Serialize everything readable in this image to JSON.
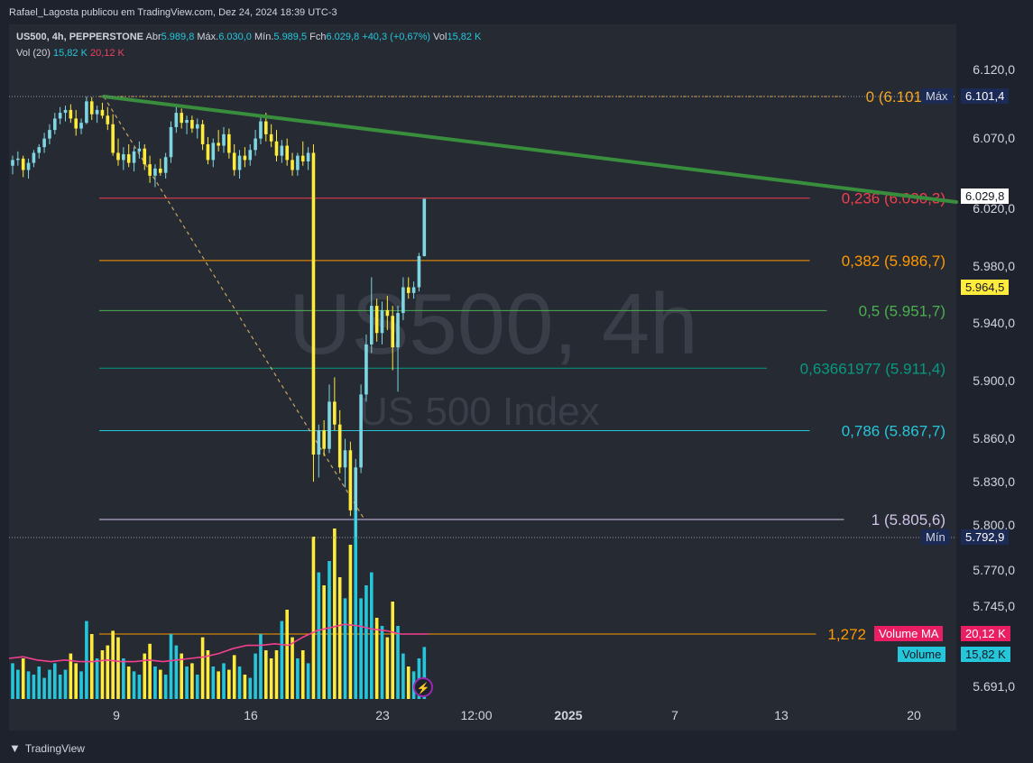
{
  "publisher_line": "Rafael_Lagosta publicou em TradingView.com, Dez 24, 2024 18:39 UTC-3",
  "legend": {
    "symbol": "US500, 4h, PEPPERSTONE",
    "open_label": "Abr",
    "open": "5.989,8",
    "high_label": "Máx.",
    "high": "6.030,0",
    "low_label": "Mín.",
    "low": "5.989,5",
    "close_label": "Fch",
    "close": "6.029,8",
    "change": "+40,3 (+0,67%)",
    "vol_label": "Vol",
    "vol": "15,82 K",
    "vol_indicator": "Vol (20)",
    "vol_value": "15,82 K",
    "vol_ma_value": "20,12 K"
  },
  "watermark": {
    "line1": "US500, 4h",
    "line2": "US 500 Index"
  },
  "price_scale": {
    "ticks": [
      "6.120,0",
      "6.070,0",
      "6.020,0",
      "5.980,0",
      "5.940,0",
      "5.900,0",
      "5.860,0",
      "5.830,0",
      "5.800,0",
      "5.770,0",
      "5.745,0",
      "5.691,0"
    ],
    "max_label": "Máx",
    "max_value": "6.101,4",
    "last_price": "6.029,8",
    "second_price": "5.964,5",
    "min_label": "Mín",
    "min_value": "5.792,9",
    "volume_ma_label": "Volume MA",
    "volume_ma_value": "20,12 K",
    "volume_label": "Volume",
    "volume_value": "15,82 K"
  },
  "time_scale": {
    "ticks": [
      "9",
      "16",
      "23",
      "12:00",
      "2025",
      "7",
      "13",
      "20"
    ]
  },
  "fib_levels": [
    {
      "label": "0 (6.101",
      "color": "#f5a623"
    },
    {
      "label": "0,236 (6.030,3)",
      "color": "#f23f4d"
    },
    {
      "label": "0,382 (5.986,7)",
      "color": "#ff9800"
    },
    {
      "label": "0,5 (5.951,7)",
      "color": "#4caf50"
    },
    {
      "label": "0,63661977 (5.911,4)",
      "color": "#089981"
    },
    {
      "label": "0,786 (5.867,7)",
      "color": "#26c6da"
    },
    {
      "label": "1 (5.805,6)",
      "color": "#d1c4e9"
    },
    {
      "label": "1,272",
      "color": "#ff9800"
    }
  ],
  "footer": {
    "brand": "TradingView"
  },
  "chart_data": {
    "type": "candlestick",
    "title": "US500, 4h, PEPPERSTONE",
    "subtitle": "US 500 Index",
    "ylim": [
      5691,
      6130
    ],
    "x_ticks": [
      "9",
      "16",
      "23",
      "12:00",
      "2025",
      "7",
      "13",
      "20"
    ],
    "candles": [
      {
        "o": 6053,
        "h": 6060,
        "l": 6047,
        "c": 6057,
        "v": 0.22
      },
      {
        "o": 6057,
        "h": 6063,
        "l": 6053,
        "c": 6058,
        "v": 0.18
      },
      {
        "o": 6058,
        "h": 6060,
        "l": 6045,
        "c": 6050,
        "v": 0.25
      },
      {
        "o": 6050,
        "h": 6058,
        "l": 6044,
        "c": 6055,
        "v": 0.17
      },
      {
        "o": 6055,
        "h": 6064,
        "l": 6052,
        "c": 6062,
        "v": 0.15
      },
      {
        "o": 6062,
        "h": 6068,
        "l": 6058,
        "c": 6066,
        "v": 0.2
      },
      {
        "o": 6066,
        "h": 6076,
        "l": 6062,
        "c": 6072,
        "v": 0.13
      },
      {
        "o": 6072,
        "h": 6082,
        "l": 6068,
        "c": 6078,
        "v": 0.18
      },
      {
        "o": 6078,
        "h": 6090,
        "l": 6075,
        "c": 6086,
        "v": 0.22
      },
      {
        "o": 6086,
        "h": 6094,
        "l": 6082,
        "c": 6090,
        "v": 0.15
      },
      {
        "o": 6090,
        "h": 6095,
        "l": 6084,
        "c": 6092,
        "v": 0.18
      },
      {
        "o": 6092,
        "h": 6096,
        "l": 6083,
        "c": 6086,
        "v": 0.28
      },
      {
        "o": 6086,
        "h": 6092,
        "l": 6074,
        "c": 6079,
        "v": 0.22
      },
      {
        "o": 6079,
        "h": 6086,
        "l": 6075,
        "c": 6083,
        "v": 0.17
      },
      {
        "o": 6083,
        "h": 6101.4,
        "l": 6082,
        "c": 6098,
        "v": 0.48
      },
      {
        "o": 6098,
        "h": 6101,
        "l": 6085,
        "c": 6089,
        "v": 0.4
      },
      {
        "o": 6089,
        "h": 6095,
        "l": 6083,
        "c": 6092,
        "v": 0.25
      },
      {
        "o": 6092,
        "h": 6097,
        "l": 6086,
        "c": 6088,
        "v": 0.3
      },
      {
        "o": 6088,
        "h": 6094,
        "l": 6078,
        "c": 6082,
        "v": 0.33
      },
      {
        "o": 6082,
        "h": 6089,
        "l": 6060,
        "c": 6062,
        "v": 0.42
      },
      {
        "o": 6062,
        "h": 6072,
        "l": 6053,
        "c": 6057,
        "v": 0.38
      },
      {
        "o": 6057,
        "h": 6066,
        "l": 6050,
        "c": 6061,
        "v": 0.25
      },
      {
        "o": 6061,
        "h": 6068,
        "l": 6052,
        "c": 6055,
        "v": 0.2
      },
      {
        "o": 6055,
        "h": 6066,
        "l": 6049,
        "c": 6063,
        "v": 0.17
      },
      {
        "o": 6063,
        "h": 6070,
        "l": 6058,
        "c": 6065,
        "v": 0.15
      },
      {
        "o": 6065,
        "h": 6068,
        "l": 6050,
        "c": 6054,
        "v": 0.28
      },
      {
        "o": 6054,
        "h": 6060,
        "l": 6041,
        "c": 6046,
        "v": 0.34
      },
      {
        "o": 6046,
        "h": 6054,
        "l": 6038,
        "c": 6051,
        "v": 0.2
      },
      {
        "o": 6051,
        "h": 6058,
        "l": 6046,
        "c": 6048,
        "v": 0.18
      },
      {
        "o": 6048,
        "h": 6062,
        "l": 6044,
        "c": 6059,
        "v": 0.15
      },
      {
        "o": 6059,
        "h": 6084,
        "l": 6055,
        "c": 6080,
        "v": 0.4
      },
      {
        "o": 6080,
        "h": 6096,
        "l": 6076,
        "c": 6090,
        "v": 0.33
      },
      {
        "o": 6090,
        "h": 6093,
        "l": 6079,
        "c": 6083,
        "v": 0.28
      },
      {
        "o": 6083,
        "h": 6088,
        "l": 6075,
        "c": 6085,
        "v": 0.2
      },
      {
        "o": 6085,
        "h": 6088,
        "l": 6076,
        "c": 6079,
        "v": 0.22
      },
      {
        "o": 6079,
        "h": 6086,
        "l": 6072,
        "c": 6082,
        "v": 0.15
      },
      {
        "o": 6082,
        "h": 6085,
        "l": 6064,
        "c": 6068,
        "v": 0.38
      },
      {
        "o": 6068,
        "h": 6073,
        "l": 6054,
        "c": 6057,
        "v": 0.3
      },
      {
        "o": 6057,
        "h": 6072,
        "l": 6052,
        "c": 6069,
        "v": 0.2
      },
      {
        "o": 6069,
        "h": 6078,
        "l": 6063,
        "c": 6067,
        "v": 0.17
      },
      {
        "o": 6067,
        "h": 6080,
        "l": 6062,
        "c": 6075,
        "v": 0.22
      },
      {
        "o": 6075,
        "h": 6079,
        "l": 6058,
        "c": 6062,
        "v": 0.18
      },
      {
        "o": 6062,
        "h": 6068,
        "l": 6046,
        "c": 6050,
        "v": 0.27
      },
      {
        "o": 6050,
        "h": 6064,
        "l": 6044,
        "c": 6060,
        "v": 0.2
      },
      {
        "o": 6060,
        "h": 6066,
        "l": 6052,
        "c": 6057,
        "v": 0.15
      },
      {
        "o": 6057,
        "h": 6068,
        "l": 6053,
        "c": 6064,
        "v": 0.13
      },
      {
        "o": 6064,
        "h": 6078,
        "l": 6060,
        "c": 6072,
        "v": 0.28
      },
      {
        "o": 6072,
        "h": 6088,
        "l": 6068,
        "c": 6084,
        "v": 0.4
      },
      {
        "o": 6084,
        "h": 6090,
        "l": 6070,
        "c": 6075,
        "v": 0.3
      },
      {
        "o": 6075,
        "h": 6082,
        "l": 6066,
        "c": 6070,
        "v": 0.25
      },
      {
        "o": 6070,
        "h": 6078,
        "l": 6056,
        "c": 6060,
        "v": 0.3
      },
      {
        "o": 6060,
        "h": 6071,
        "l": 6055,
        "c": 6067,
        "v": 0.48
      },
      {
        "o": 6067,
        "h": 6072,
        "l": 6053,
        "c": 6057,
        "v": 0.55
      },
      {
        "o": 6057,
        "h": 6062,
        "l": 6046,
        "c": 6050,
        "v": 0.38
      },
      {
        "o": 6050,
        "h": 6062,
        "l": 6046,
        "c": 6060,
        "v": 0.25
      },
      {
        "o": 6060,
        "h": 6070,
        "l": 6053,
        "c": 6056,
        "v": 0.3
      },
      {
        "o": 6056,
        "h": 6066,
        "l": 6050,
        "c": 6062,
        "v": 0.22
      },
      {
        "o": 6062,
        "h": 6068,
        "l": 5832,
        "c": 5851,
        "v": 1.0
      },
      {
        "o": 5851,
        "h": 5872,
        "l": 5835,
        "c": 5868,
        "v": 0.78
      },
      {
        "o": 5868,
        "h": 5875,
        "l": 5850,
        "c": 5855,
        "v": 0.7
      },
      {
        "o": 5855,
        "h": 5900,
        "l": 5852,
        "c": 5888,
        "v": 0.85
      },
      {
        "o": 5888,
        "h": 5905,
        "l": 5868,
        "c": 5872,
        "v": 1.05
      },
      {
        "o": 5872,
        "h": 5882,
        "l": 5838,
        "c": 5842,
        "v": 0.75
      },
      {
        "o": 5842,
        "h": 5862,
        "l": 5828,
        "c": 5854,
        "v": 0.62
      },
      {
        "o": 5854,
        "h": 5860,
        "l": 5808,
        "c": 5812,
        "v": 0.95
      },
      {
        "o": 5812,
        "h": 5848,
        "l": 5792.9,
        "c": 5842,
        "v": 1.2
      },
      {
        "o": 5842,
        "h": 5900,
        "l": 5838,
        "c": 5893,
        "v": 0.62
      },
      {
        "o": 5893,
        "h": 5935,
        "l": 5888,
        "c": 5928,
        "v": 0.7
      },
      {
        "o": 5928,
        "h": 5975,
        "l": 5922,
        "c": 5955,
        "v": 0.78
      },
      {
        "o": 5955,
        "h": 5960,
        "l": 5930,
        "c": 5936,
        "v": 0.5
      },
      {
        "o": 5936,
        "h": 5958,
        "l": 5928,
        "c": 5952,
        "v": 0.45
      },
      {
        "o": 5952,
        "h": 5962,
        "l": 5938,
        "c": 5948,
        "v": 0.38
      },
      {
        "o": 5948,
        "h": 5955,
        "l": 5910,
        "c": 5926,
        "v": 0.6
      },
      {
        "o": 5926,
        "h": 5955,
        "l": 5895,
        "c": 5950,
        "v": 0.45
      },
      {
        "o": 5950,
        "h": 5975,
        "l": 5945,
        "c": 5968,
        "v": 0.28
      },
      {
        "o": 5968,
        "h": 5975,
        "l": 5960,
        "c": 5964,
        "v": 0.2
      },
      {
        "o": 5964,
        "h": 5972,
        "l": 5960,
        "c": 5968,
        "v": 0.17
      },
      {
        "o": 5968,
        "h": 5992,
        "l": 5965,
        "c": 5989.8,
        "v": 0.25
      },
      {
        "o": 5989.8,
        "h": 6030,
        "l": 5989.5,
        "c": 6029.8,
        "v": 0.32
      }
    ],
    "volume_ma": [
      0.25,
      0.26,
      0.24,
      0.23,
      0.24,
      0.23,
      0.23,
      0.24,
      0.23,
      0.23,
      0.24,
      0.23,
      0.24,
      0.25,
      0.26,
      0.28,
      0.31,
      0.33,
      0.33,
      0.34,
      0.33,
      0.38,
      0.42,
      0.44,
      0.46,
      0.45,
      0.43,
      0.42,
      0.4,
      0.4,
      0.4
    ],
    "max_price": 6101.4,
    "min_price": 5792.9,
    "last_price": 6029.8
  }
}
